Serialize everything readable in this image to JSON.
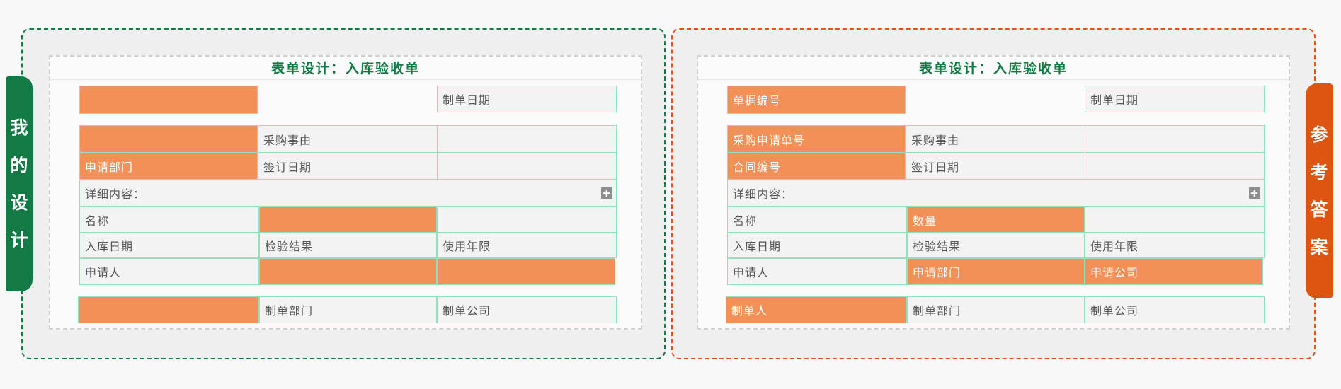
{
  "left": {
    "tab_chars": [
      "我",
      "的",
      "设",
      "计"
    ],
    "form_title": "表单设计：入库验收单",
    "cells": [
      "",
      "制单日期",
      "",
      "采购事由",
      "",
      "申请部门",
      "签订日期",
      "",
      "详细内容：",
      "名称",
      "",
      "",
      "入库日期",
      "检验结果",
      "使用年限",
      "申请人",
      "",
      "",
      "",
      "制单部门",
      "制单公司"
    ]
  },
  "right": {
    "tab_chars": [
      "参",
      "考",
      "答",
      "案"
    ],
    "form_title": "表单设计：入库验收单",
    "cells": [
      "单据编号",
      "制单日期",
      "采购申请单号",
      "采购事由",
      "",
      "合同编号",
      "签订日期",
      "",
      "详细内容：",
      "名称",
      "数量",
      "",
      "入库日期",
      "检验结果",
      "使用年限",
      "申请人",
      "申请部门",
      "申请公司",
      "制单人",
      "制单部门",
      "制单公司"
    ]
  },
  "colors": {
    "green_accent": "#137a46",
    "orange_accent": "#dd5511",
    "cell_orange": "#f29058",
    "cell_border": "#9adcbb",
    "cell_bg": "#f3f3f3"
  }
}
